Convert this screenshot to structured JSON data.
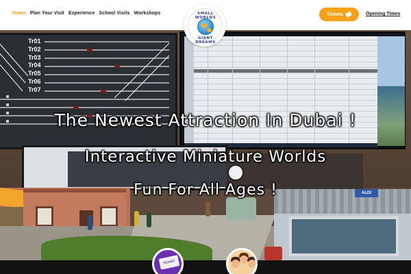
{
  "header": {
    "nav": [
      {
        "label": "Home",
        "active": true
      },
      {
        "label": "Plan Your Visit",
        "active": false
      },
      {
        "label": "Experience",
        "active": false
      },
      {
        "label": "School Visits",
        "active": false
      },
      {
        "label": "Workshops",
        "active": false
      }
    ],
    "logo": {
      "top_text": "SMALL WORLDS",
      "bottom_text": "GIANT DREAMS"
    },
    "tickets_label": "Tickets",
    "opening_label": "Opening Times"
  },
  "hero": {
    "line1": "The Newest Attraction In Dubai !",
    "line2": "Interactive Miniature Worlds",
    "line3": "Fun For All Ages !",
    "track_labels": [
      "Tr01",
      "Tr02",
      "Tr03",
      "Tr04",
      "Tr05",
      "Tr06",
      "Tr07"
    ],
    "shop_sign": "ALDI"
  },
  "bottom": {
    "ticket_card_text": "TICKET"
  },
  "colors": {
    "accent": "#f5a21a",
    "nav_text": "#1b1b1b",
    "ticket_circle": "#6a2fb3"
  }
}
